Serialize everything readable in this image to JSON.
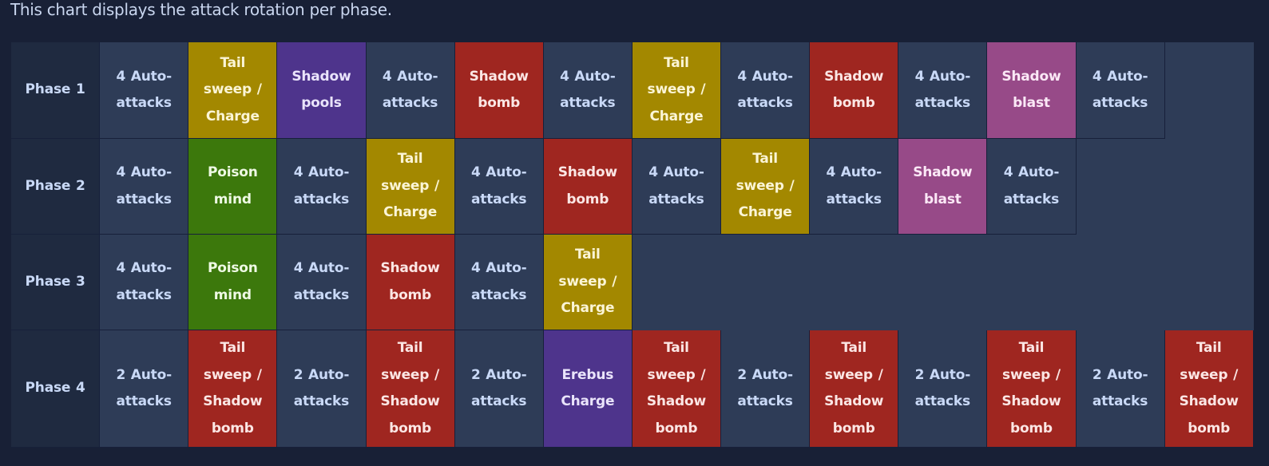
{
  "caption": "This chart displays the attack rotation per phase.",
  "colors": {
    "page_background": "#182036",
    "phase_cell": "#1f2a40",
    "auto_attack_cell": "#2e3c57",
    "tail_sweep_charge": "#a38800",
    "shadow_bomb": "#9f2620",
    "shadow_pools": "#4e348c",
    "erebus_charge": "#4e348c",
    "shadow_blast": "#974a88",
    "poison_mind": "#3c780c"
  },
  "phases": [
    {
      "label": "Phase 1",
      "attacks": [
        {
          "name": "4 Auto-attacks",
          "type": "auto"
        },
        {
          "name": "Tail sweep / Charge",
          "type": "yellow"
        },
        {
          "name": "Shadow pools",
          "type": "purple"
        },
        {
          "name": "4 Auto-attacks",
          "type": "auto"
        },
        {
          "name": "Shadow bomb",
          "type": "red"
        },
        {
          "name": "4 Auto-attacks",
          "type": "auto"
        },
        {
          "name": "Tail sweep / Charge",
          "type": "yellow"
        },
        {
          "name": "4 Auto-attacks",
          "type": "auto"
        },
        {
          "name": "Shadow bomb",
          "type": "red"
        },
        {
          "name": "4 Auto-attacks",
          "type": "auto"
        },
        {
          "name": "Shadow blast",
          "type": "pink"
        },
        {
          "name": "4 Auto-attacks",
          "type": "auto"
        }
      ]
    },
    {
      "label": "Phase 2",
      "attacks": [
        {
          "name": "4 Auto-attacks",
          "type": "auto"
        },
        {
          "name": "Poison mind",
          "type": "green"
        },
        {
          "name": "4 Auto-attacks",
          "type": "auto"
        },
        {
          "name": "Tail sweep / Charge",
          "type": "yellow"
        },
        {
          "name": "4 Auto-attacks",
          "type": "auto"
        },
        {
          "name": "Shadow bomb",
          "type": "red"
        },
        {
          "name": "4 Auto-attacks",
          "type": "auto"
        },
        {
          "name": "Tail sweep / Charge",
          "type": "yellow"
        },
        {
          "name": "4 Auto-attacks",
          "type": "auto"
        },
        {
          "name": "Shadow blast",
          "type": "pink"
        },
        {
          "name": "4 Auto-attacks",
          "type": "auto"
        }
      ]
    },
    {
      "label": "Phase 3",
      "attacks": [
        {
          "name": "4 Auto-attacks",
          "type": "auto"
        },
        {
          "name": "Poison mind",
          "type": "green"
        },
        {
          "name": "4 Auto-attacks",
          "type": "auto"
        },
        {
          "name": "Shadow bomb",
          "type": "red"
        },
        {
          "name": "4 Auto-attacks",
          "type": "auto"
        },
        {
          "name": "Tail sweep / Charge",
          "type": "yellow"
        }
      ]
    },
    {
      "label": "Phase 4",
      "attacks": [
        {
          "name": "2 Auto-attacks",
          "type": "auto"
        },
        {
          "name": "Tail sweep / Shadow bomb",
          "type": "red"
        },
        {
          "name": "2 Auto-attacks",
          "type": "auto"
        },
        {
          "name": "Tail sweep / Shadow bomb",
          "type": "red"
        },
        {
          "name": "2 Auto-attacks",
          "type": "auto"
        },
        {
          "name": "Erebus Charge",
          "type": "purple"
        },
        {
          "name": "Tail sweep / Shadow bomb",
          "type": "red"
        },
        {
          "name": "2 Auto-attacks",
          "type": "auto"
        },
        {
          "name": "Tail sweep / Shadow bomb",
          "type": "red"
        },
        {
          "name": "2 Auto-attacks",
          "type": "auto"
        },
        {
          "name": "Tail sweep / Shadow bomb",
          "type": "red"
        },
        {
          "name": "2 Auto-attacks",
          "type": "auto"
        },
        {
          "name": "Tail sweep / Shadow bomb",
          "type": "red"
        }
      ]
    }
  ]
}
